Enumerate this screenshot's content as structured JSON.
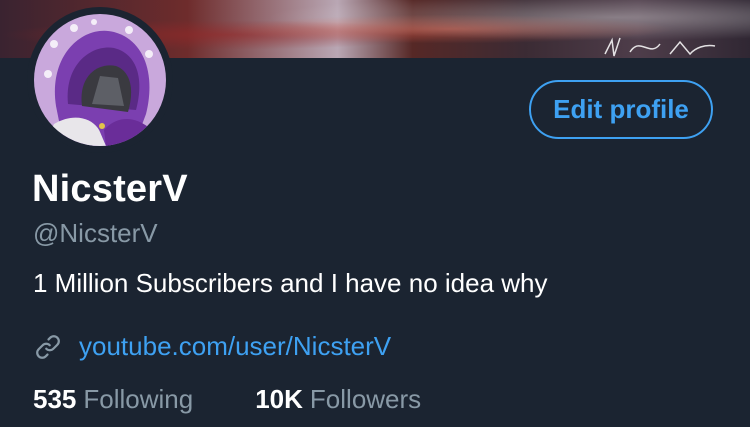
{
  "profile": {
    "display_name": "NicsterV",
    "handle": "@NicsterV",
    "bio": "1 Million Subscribers and I have no idea why",
    "website": "youtube.com/user/NicsterV",
    "edit_button_label": "Edit profile"
  },
  "stats": {
    "following_count": "535",
    "following_label": "Following",
    "followers_count": "10K",
    "followers_label": "Followers"
  },
  "colors": {
    "background": "#1b2431",
    "accent": "#3ea1f2",
    "secondary_text": "#8899a6"
  },
  "icons": {
    "link": "link-icon",
    "avatar": "hooded-purple-character-avatar"
  }
}
